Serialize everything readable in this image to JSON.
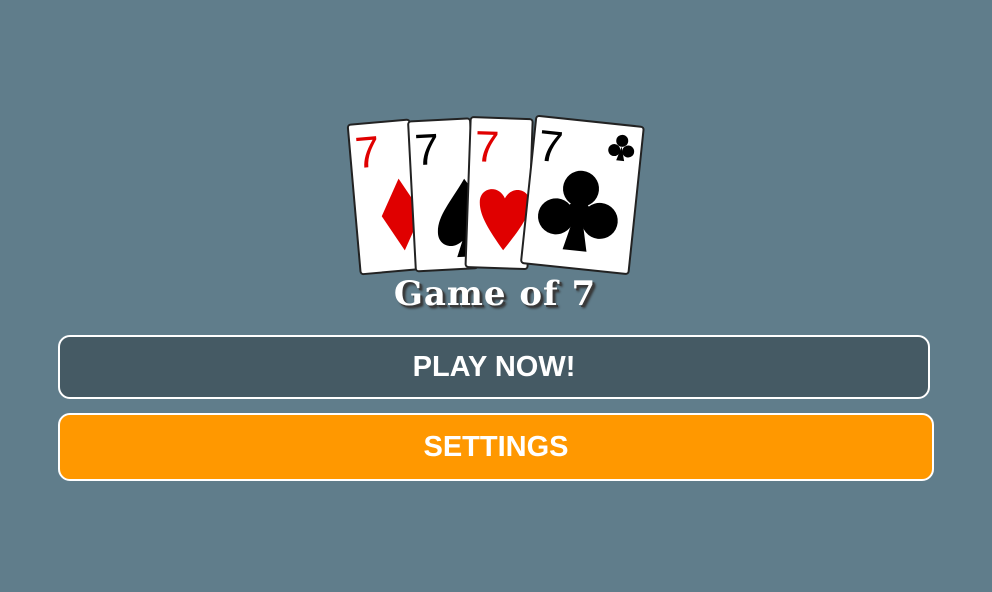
{
  "logo": {
    "cards": [
      {
        "rank": "7",
        "suit": "diamond",
        "color": "#e00000"
      },
      {
        "rank": "7",
        "suit": "spade",
        "color": "#000000"
      },
      {
        "rank": "7",
        "suit": "heart",
        "color": "#e00000"
      },
      {
        "rank": "7",
        "suit": "club",
        "color": "#000000"
      }
    ],
    "title": "Game of 7"
  },
  "menu": {
    "play_label": "PLAY NOW!",
    "settings_label": "SETTINGS"
  },
  "colors": {
    "background": "#607d8b",
    "play_button": "#455a64",
    "settings_button": "#ff9800",
    "red_suit": "#e00000",
    "black_suit": "#000000"
  }
}
